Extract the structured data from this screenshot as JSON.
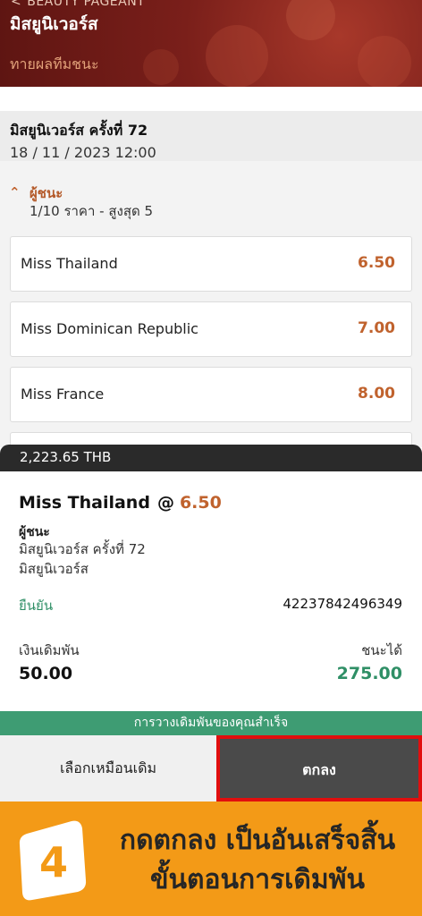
{
  "header": {
    "breadcrumb": "BEAUTY PAGEANT",
    "title": "มิสยูนิเวอร์ส",
    "subtitle": "ทายผลทีมชนะ"
  },
  "event": {
    "title": "มิสยูนิเวอร์ส ครั้งที่ 72",
    "datetime": "18 / 11 / 2023 12:00"
  },
  "market": {
    "name": "ผู้ชนะ",
    "rule": "1/10 ราคา - สูงสุด 5",
    "options": [
      {
        "name": "Miss Thailand",
        "price": "6.50"
      },
      {
        "name": "Miss Dominican Republic",
        "price": "7.00"
      },
      {
        "name": "Miss France",
        "price": "8.00"
      }
    ]
  },
  "betslip": {
    "balance": "2,223.65 THB",
    "selection": "Miss Thailand",
    "at": "@",
    "price": "6.50",
    "market": "ผู้ชนะ",
    "event": "มิสยูนิเวอร์ส ครั้งที่ 72",
    "category": "มิสยูนิเวอร์ส",
    "confirm_label": "ยืนยัน",
    "reference": "42237842496349",
    "stake_label": "เงินเดิมพัน",
    "stake": "50.00",
    "win_label": "ชนะได้",
    "win": "275.00",
    "success_message": "การวางเดิมพันของคุณสำเร็จ",
    "reuse_button": "เลือกเหมือนเดิม",
    "ok_button": "ตกลง"
  },
  "instruction": {
    "step": "4",
    "line1": "กดตกลง เป็นอันเสร็จสิ้น",
    "line2": "ขั้นตอนการเดิมพัน"
  },
  "colors": {
    "header_bg": "#7a1f1a",
    "accent_orange": "#c0622d",
    "success_green": "#3e9c73",
    "banner_orange": "#f39a17",
    "highlight_red": "#e10e0e"
  }
}
